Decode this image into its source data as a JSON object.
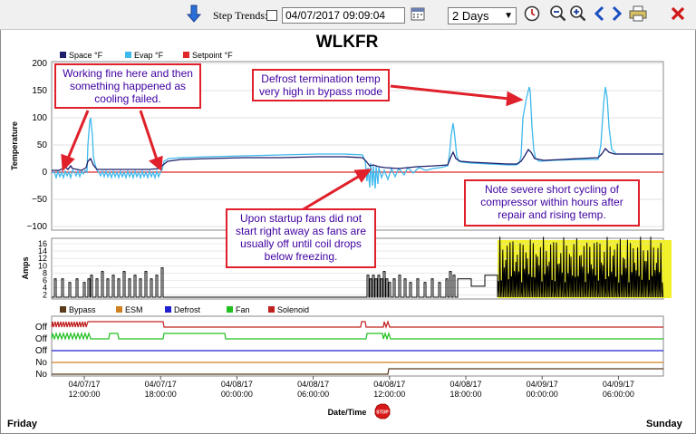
{
  "toolbar": {
    "step_trends_label": "Step Trends:",
    "date_value": "04/07/2017 09:09:04",
    "range_value": "2 Days"
  },
  "chart_title": "WLKFR",
  "colors": {
    "space": "#1f1f6b",
    "evap": "#3fb8ec",
    "setpoint": "#e02828",
    "highlight": "#f2f02a",
    "callout_border": "#e0202a",
    "callout_text": "#3f00a0",
    "bypass": "#5a3a1a",
    "esm": "#d08020",
    "defrost": "#2020d0",
    "fan": "#20c020",
    "solenoid": "#c02020"
  },
  "legend_top": [
    "Space °F",
    "Evap °F",
    "Setpoint °F"
  ],
  "legend_bottom": [
    "Bypass",
    "ESM",
    "Defrost",
    "Fan",
    "Solenoid"
  ],
  "axes": {
    "temp_label": "Temperature",
    "amps_label": "Amps",
    "x_label": "Date/Time",
    "temp_ticks": [
      "200",
      "150",
      "100",
      "50",
      "0",
      "−50",
      "−100"
    ],
    "amps_ticks": [
      "16",
      "14",
      "12",
      "10",
      "8",
      "6",
      "4",
      "2"
    ],
    "state_labels": [
      "Off",
      "Off",
      "Off",
      "No",
      "No"
    ],
    "x_ticks": [
      {
        "date": "04/07/17",
        "time": "12:00:00"
      },
      {
        "date": "04/07/17",
        "time": "18:00:00"
      },
      {
        "date": "04/08/17",
        "time": "00:00:00"
      },
      {
        "date": "04/08/17",
        "time": "06:00:00"
      },
      {
        "date": "04/08/17",
        "time": "12:00:00"
      },
      {
        "date": "04/08/17",
        "time": "18:00:00"
      },
      {
        "date": "04/09/17",
        "time": "00:00:00"
      },
      {
        "date": "04/09/17",
        "time": "06:00:00"
      }
    ]
  },
  "callouts": {
    "working": "Working fine here and then something happened as cooling failed.",
    "defrost": "Defrost termination temp very high in bypass mode",
    "startup": "Upon startup fans did not start right away as fans are usually off until coil drops below freezing.",
    "short_cycling": "Note severe short cycling of compressor within hours after repair and rising temp."
  },
  "footer": {
    "left": "Friday",
    "right": "Sunday",
    "stop": "STOP"
  }
}
